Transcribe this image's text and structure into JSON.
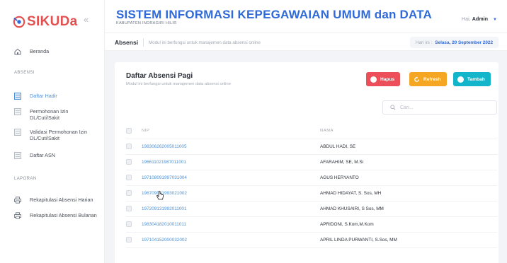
{
  "app": {
    "logo_text": "SIKUDa",
    "collapse_glyph": "«",
    "title": "SISTEM INFORMASI KEPEGAWAIAN UMUM dan DATA",
    "subtitle": "KABUPATEN INDRAGIRI HILIR",
    "user_greeting": "Hai,",
    "user_name": "Admin",
    "brand_color": "#2f6ad8",
    "logo_color": "#e35050"
  },
  "sidebar": {
    "home": {
      "label": "Beranda",
      "icon": "home-icon"
    },
    "section_absensi": "ABSENSI",
    "absensi_items": [
      {
        "label": "Daftar Hadir",
        "icon": "list-icon",
        "active": true
      },
      {
        "label": "Permohonan Izin DL/Cuti/Sakit",
        "icon": "document-icon"
      },
      {
        "label": "Validasi Permohonan Izin DL/Cuti/Sakit",
        "icon": "document-icon"
      },
      {
        "label": "Daftar ASN",
        "icon": "document-icon"
      }
    ],
    "section_laporan": "LAPORAN",
    "laporan_items": [
      {
        "label": "Rekapitulasi Absensi Harian",
        "icon": "print-icon"
      },
      {
        "label": "Rekapitulasi Absensi Bulanan",
        "icon": "print-icon"
      }
    ]
  },
  "pagebar": {
    "name": "Absensi",
    "description": "Modul ini berfungsi untuk manajemen data absensi online",
    "date_prefix": "Hari ini :",
    "date_value": "Selasa, 20 September 2022"
  },
  "card": {
    "title": "Daftar Absensi Pagi",
    "subtitle": "Modul ini berfungsi untuk manajemen data absensi online",
    "buttons": {
      "hapus": "Hapus",
      "refresh": "Refresh",
      "tambah": "Tambah"
    },
    "search_placeholder": "Cari...",
    "columns": [
      "NIP",
      "NAMA"
    ],
    "rows": [
      {
        "nip": "198306262005011005",
        "nama": "ABDUL HADI, SE"
      },
      {
        "nip": "196611021987011001",
        "nama": "AFARAHIM, SE, M.Si"
      },
      {
        "nip": "197108091997031004",
        "nama": "AGUS HERYANTO"
      },
      {
        "nip": "196709031993021002",
        "nama": "AHMAD HIDAYAT, S. Sos, MH"
      },
      {
        "nip": "197209131992011001",
        "nama": "AHMAD KHUSAIRI, S Sos, MM"
      },
      {
        "nip": "198304182010011011",
        "nama": "APRIDONI, S.Kom,M.Kom"
      },
      {
        "nip": "197104152000032002",
        "nama": "APRIL LINDA PURWANTI, S.Sos, MM"
      }
    ]
  },
  "colors": {
    "hapus": "#ec4f59",
    "refresh": "#f5a623",
    "tambah": "#12b5c9",
    "link": "#4a90d9"
  }
}
